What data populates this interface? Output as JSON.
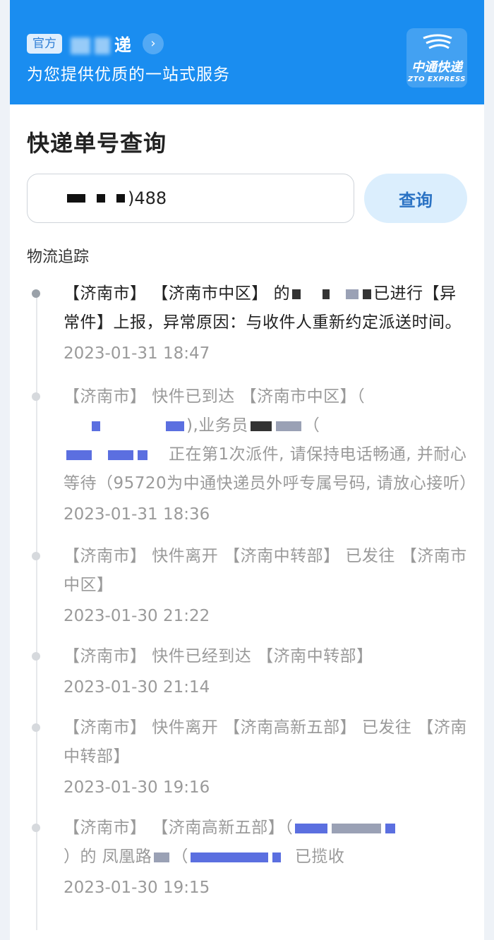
{
  "header": {
    "badge": "官方",
    "brand_name": "递",
    "tagline": "为您提供优质的一站式服务",
    "logo_cn": "中通快递",
    "logo_en": "ZTO EXPRESS"
  },
  "search": {
    "title": "快递单号查询",
    "tracking_number_visible": ")488",
    "button_label": "查询"
  },
  "tracking": {
    "label": "物流追踪",
    "events": [
      {
        "text_a": "【济南市】 【济南市中区】 的",
        "text_b": "已进行【异常件】上报，异常原因：与收件人重新约定派送时间。",
        "time": "2023-01-31 18:47"
      },
      {
        "text_a": "【济南市】 快件已到达 【济南市中区】（",
        "text_b": "),业务员",
        "text_c": "（",
        "text_d": "正在第1次派件, 请保持电话畅通, 并耐心等待（95720为中通快递员外呼专属号码, 请放心接听）",
        "time": "2023-01-31 18:36"
      },
      {
        "text_a": "【济南市】 快件离开 【济南中转部】 已发往 【济南市中区】",
        "time": "2023-01-30 21:22"
      },
      {
        "text_a": "【济南市】 快件已经到达 【济南中转部】",
        "time": "2023-01-30 21:14"
      },
      {
        "text_a": "【济南市】 快件离开 【济南高新五部】 已发往 【济南中转部】",
        "time": "2023-01-30 19:16"
      },
      {
        "text_a": "【济南市】 【济南高新五部】（",
        "text_b": "）的 凤凰路",
        "text_c": "（",
        "text_d": "已揽收",
        "time": "2023-01-30 19:15"
      }
    ]
  },
  "colors": {
    "header_blue": "#1a8df0",
    "button_bg": "#dbeefd",
    "button_text": "#2b73c4"
  }
}
